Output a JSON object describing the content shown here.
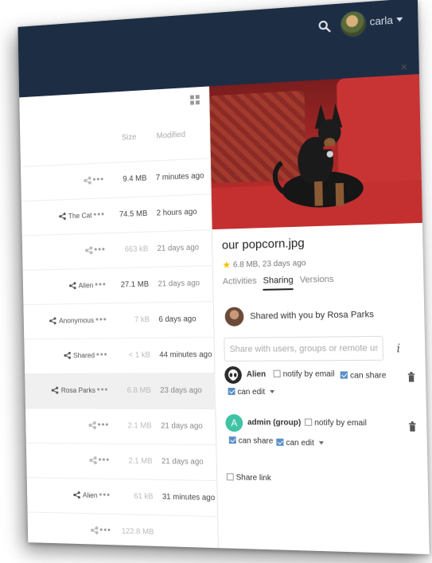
{
  "header": {
    "user_name": "carla",
    "icons": [
      "search-icon",
      "avatar",
      "caret-down-icon"
    ]
  },
  "filelist": {
    "columns": {
      "size": "Size",
      "modified": "Modified"
    },
    "rows": [
      {
        "share_label": "",
        "size": "9.4 MB",
        "modified": "7 minutes ago",
        "size_light": false,
        "mod_light": false
      },
      {
        "share_label": "The Cat",
        "size": "74.5 MB",
        "modified": "2 hours ago",
        "size_light": false,
        "mod_light": false
      },
      {
        "share_label": "",
        "size": "663 kB",
        "modified": "21 days ago",
        "size_light": true,
        "mod_light": true
      },
      {
        "share_label": "Alien",
        "size": "27.1 MB",
        "modified": "21 days ago",
        "size_light": false,
        "mod_light": true
      },
      {
        "share_label": "Anonymous",
        "size": "7 kB",
        "modified": "6 days ago",
        "size_light": true,
        "mod_light": false
      },
      {
        "share_label": "Shared",
        "size": "< 1 kB",
        "modified": "44 minutes ago",
        "size_light": true,
        "mod_light": false
      },
      {
        "share_label": "Rosa Parks",
        "size": "6.8 MB",
        "modified": "23 days ago",
        "size_light": true,
        "mod_light": true
      },
      {
        "share_label": "",
        "size": "2.1 MB",
        "modified": "21 days ago",
        "size_light": true,
        "mod_light": true
      },
      {
        "share_label": "",
        "size": "2.1 MB",
        "modified": "21 days ago",
        "size_light": true,
        "mod_light": true
      },
      {
        "share_label": "Alien",
        "size": "61 kB",
        "modified": "31 minutes ago",
        "size_light": true,
        "mod_light": false
      },
      {
        "share_label": "",
        "size": "122.8 MB",
        "modified": "",
        "size_light": true,
        "mod_light": true
      }
    ]
  },
  "sidebar": {
    "close": "×",
    "file_title": "our popcorn.jpg",
    "file_meta": "6.8 MB, 23 days ago",
    "tabs": [
      "Activities",
      "Sharing",
      "Versions"
    ],
    "active_tab": "Sharing",
    "shared_with": "Shared with you by Rosa Parks",
    "share_input_placeholder": "Share with users, groups or remote users ...",
    "recipients": [
      {
        "name": "Alien",
        "notify_label": "notify by email",
        "notify_checked": false,
        "can_share_label": "can share",
        "can_share_checked": true,
        "can_edit_label": "can edit",
        "can_edit_checked": true
      },
      {
        "name": "admin (group)",
        "avatar_letter": "A",
        "notify_label": "notify by email",
        "notify_checked": false,
        "can_share_label": "can share",
        "can_share_checked": true,
        "can_edit_label": "can edit",
        "can_edit_checked": true
      }
    ],
    "share_link_label": "Share link"
  },
  "colors": {
    "header_bg": "#1d2d44",
    "checkbox_accent": "#5b8fc7",
    "admin_avatar": "#3fc3a4",
    "star": "#f2c200"
  }
}
